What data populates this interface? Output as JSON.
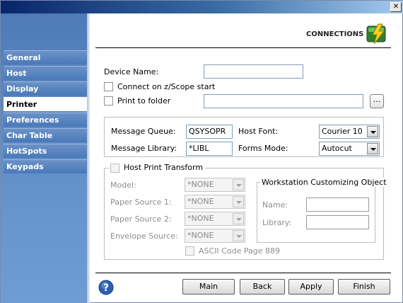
{
  "window": {
    "close_glyph": "✕"
  },
  "sidebar": {
    "items": [
      {
        "label": "General"
      },
      {
        "label": "Host"
      },
      {
        "label": "Display"
      },
      {
        "label": "Printer"
      },
      {
        "label": "Preferences"
      },
      {
        "label": "Char Table"
      },
      {
        "label": "HotSpots"
      },
      {
        "label": "Keypads"
      }
    ],
    "active": "Printer"
  },
  "header": {
    "title": "CONNECTIONS",
    "icon": "connections-icon"
  },
  "form": {
    "device_name_label": "Device Name:",
    "device_name_value": "",
    "connect_on_start_label": "Connect on z/Scope start",
    "connect_on_start_checked": false,
    "print_to_folder_label": "Print to folder",
    "print_to_folder_checked": false,
    "folder_value": "",
    "browse_label": "...",
    "message_queue_label": "Message Queue:",
    "message_queue_value": "QSYSOPR",
    "message_library_label": "Message Library:",
    "message_library_value": "*LIBL",
    "host_font_label": "Host Font:",
    "host_font_value": "Courier 10",
    "forms_mode_label": "Forms Mode:",
    "forms_mode_value": "Autocut"
  },
  "hpt": {
    "label": "Host Print Transform",
    "checked": false,
    "model_label": "Model:",
    "model_value": "*NONE",
    "paper_source_1_label": "Paper Source 1:",
    "paper_source_1_value": "*NONE",
    "paper_source_2_label": "Paper Source 2:",
    "paper_source_2_value": "*NONE",
    "envelope_source_label": "Envelope Source:",
    "envelope_source_value": "*NONE",
    "ascii_label": "ASCII Code Page 889",
    "ascii_checked": false,
    "wco_title": "Workstation Customizing Object",
    "wco_name_label": "Name:",
    "wco_name_value": "",
    "wco_library_label": "Library:",
    "wco_library_value": ""
  },
  "footer": {
    "help_icon": "help-icon",
    "main": "Main",
    "back": "Back",
    "apply": "Apply",
    "finish": "Finish"
  },
  "colors": {
    "sidebar_blue": "#4f7ab8",
    "title_dark": "#0a246a",
    "active_item_bg": "#ffffff"
  }
}
